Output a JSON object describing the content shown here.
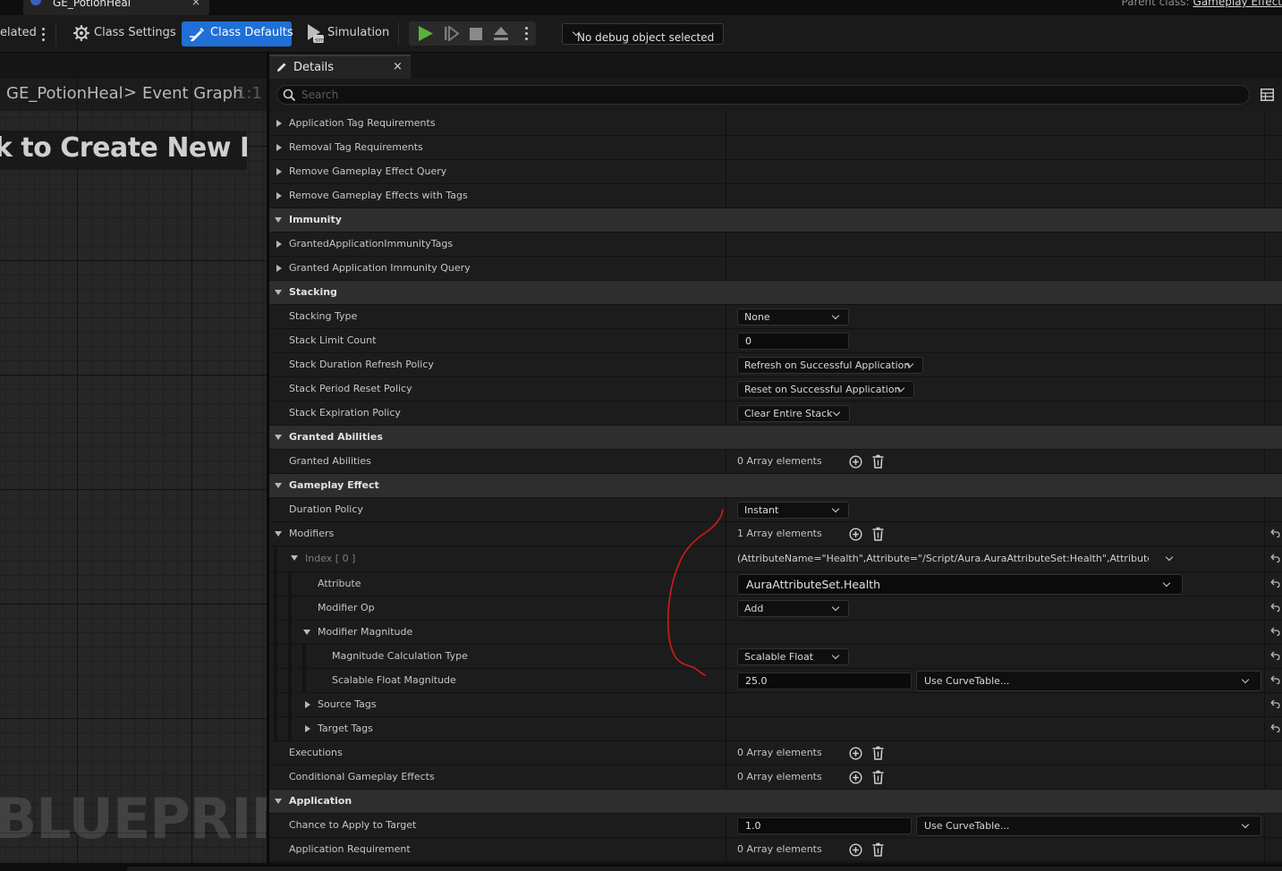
{
  "window": {
    "tab_title": "GE_PotionHeal",
    "tab_close": "×",
    "parent_class_label": "Parent class:",
    "parent_class_value": "Gameplay Effect"
  },
  "toolbar": {
    "related_label": "elated",
    "class_settings_label": "Class Settings",
    "class_defaults_label": "Class Defaults",
    "simulation_label": "Simulation",
    "debug_object_label": "No debug object selected",
    "accent_color": "#1f6fd6",
    "play_color": "#58b33a"
  },
  "graph": {
    "breadcrumb_root": "GE_PotionHeal",
    "breadcrumb_sep": ">",
    "breadcrumb_current": "Event Graph",
    "zoom": "1:1",
    "hint": "k to Create New Node:",
    "watermark": "BLUEPRINT"
  },
  "details": {
    "tab_label": "Details",
    "tab_close": "×",
    "search_placeholder": "Search",
    "rows": {
      "application_tag_requirements": "Application Tag Requirements",
      "removal_tag_requirements": "Removal Tag Requirements",
      "remove_gameplay_effect_query": "Remove Gameplay Effect Query",
      "remove_gameplay_effects_with_tags": "Remove Gameplay Effects with Tags",
      "immunity": "Immunity",
      "granted_application_immunity_tags": "GrantedApplicationImmunityTags",
      "granted_application_immunity_query": "Granted Application Immunity Query",
      "stacking": "Stacking",
      "stacking_type": "Stacking Type",
      "stacking_type_value": "None",
      "stack_limit_count": "Stack Limit Count",
      "stack_limit_count_value": "0",
      "stack_duration_refresh_policy": "Stack Duration Refresh Policy",
      "stack_duration_refresh_policy_value": "Refresh on Successful Application",
      "stack_period_reset_policy": "Stack Period Reset Policy",
      "stack_period_reset_policy_value": "Reset on Successful Application",
      "stack_expiration_policy": "Stack Expiration Policy",
      "stack_expiration_policy_value": "Clear Entire Stack",
      "granted_abilities_cat": "Granted Abilities",
      "granted_abilities": "Granted Abilities",
      "granted_abilities_value": "0 Array elements",
      "gameplay_effect": "Gameplay Effect",
      "duration_policy": "Duration Policy",
      "duration_policy_value": "Instant",
      "modifiers": "Modifiers",
      "modifiers_value": "1 Array elements",
      "index0": "Index [ 0 ]",
      "index0_value": "(AttributeName=\"Health\",Attribute=\"/Script/Aura.AuraAttributeSet:Health\",AttributeOwner=\"/Script/Aura.AuraAttributeSet\")",
      "attribute": "Attribute",
      "attribute_value": "AuraAttributeSet.Health",
      "modifier_op": "Modifier Op",
      "modifier_op_value": "Add",
      "modifier_magnitude": "Modifier Magnitude",
      "magnitude_calculation_type": "Magnitude Calculation Type",
      "magnitude_calculation_type_value": "Scalable Float",
      "scalable_float_magnitude": "Scalable Float Magnitude",
      "scalable_float_magnitude_value": "25.0",
      "use_curve_table": "Use CurveTable...",
      "source_tags": "Source Tags",
      "target_tags": "Target Tags",
      "executions": "Executions",
      "executions_value": "0 Array elements",
      "conditional_gameplay_effects": "Conditional Gameplay Effects",
      "conditional_gameplay_effects_value": "0 Array elements",
      "application": "Application",
      "chance_to_apply_to_target": "Chance to Apply to Target",
      "chance_to_apply_to_target_value": "1.0",
      "application_requirement": "Application Requirement",
      "application_requirement_value": "0 Array elements"
    }
  },
  "annotation": {
    "color": "#d41a1a"
  }
}
